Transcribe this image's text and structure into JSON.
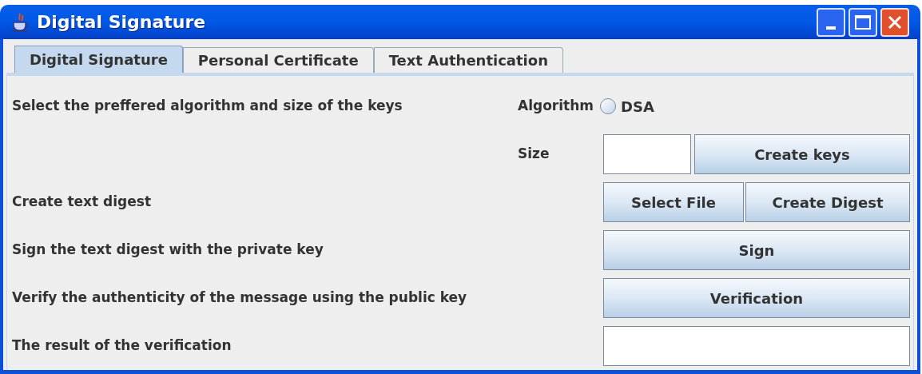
{
  "window": {
    "title": "Digital Signature"
  },
  "tabs": [
    {
      "label": "Digital Signature",
      "selected": true
    },
    {
      "label": "Personal Certificate",
      "selected": false
    },
    {
      "label": "Text Authentication",
      "selected": false
    }
  ],
  "rows": [
    {
      "label": "Select the preffered algorithm and size of the keys",
      "middle_label": "Algorithm",
      "controls": [
        {
          "kind": "radio",
          "label": "DSA",
          "selected": false
        }
      ]
    },
    {
      "middle_label": "Size",
      "controls": [
        {
          "kind": "field"
        },
        {
          "kind": "button",
          "label": "Create keys"
        }
      ]
    },
    {
      "label": "Create text digest",
      "controls": [
        {
          "kind": "button",
          "label": "Select File"
        },
        {
          "kind": "button",
          "label": "Create Digest"
        }
      ]
    },
    {
      "label": "Sign the text digest with the private key",
      "controls": [
        {
          "kind": "button",
          "label": "Sign"
        }
      ]
    },
    {
      "label": "Verify the authenticity of the message using the public key",
      "controls": [
        {
          "kind": "button",
          "label": "Verification"
        }
      ]
    },
    {
      "label": "The result of the verification",
      "controls": [
        {
          "kind": "field"
        }
      ]
    }
  ]
}
